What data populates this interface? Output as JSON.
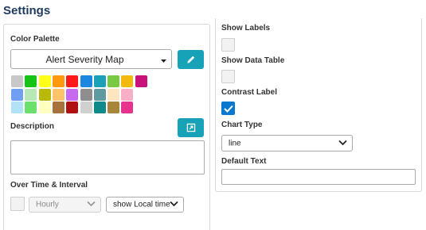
{
  "page": {
    "title": "Settings"
  },
  "left": {
    "color_palette": {
      "label": "Color Palette",
      "selected": "Alert Severity Map",
      "edit_icon": "pencil-icon",
      "swatches": [
        [
          "#c8c8c8",
          "#15c415",
          "#ffff1a",
          "#ff9a0e",
          "#ff1a1a",
          "#1b87e0",
          "#1aa0b8",
          "#7ac943",
          "#f2b90f",
          "#c8127a"
        ],
        [
          "#6f9ff2",
          "#b7e9b7",
          "#b9b90a",
          "#ffc46a",
          "#c86af0",
          "#8e8e8e",
          "#5e9aa0",
          "#fde5c0",
          "#f9aec7"
        ],
        [
          "#b1e2f5",
          "#6be06b",
          "#ffffc0",
          "#a8733a",
          "#b01010",
          "#d0d0d0",
          "#0e8a8a",
          "#a8853a",
          "#e7338e"
        ]
      ]
    },
    "description": {
      "label": "Description",
      "expand_icon": "expand-icon",
      "value": ""
    },
    "over_time": {
      "label": "Over Time & Interval",
      "interval": "Hourly",
      "time_mode": "show Local time"
    }
  },
  "right": {
    "show_labels": {
      "label": "Show Labels",
      "checked": false
    },
    "show_data_table": {
      "label": "Show Data Table",
      "checked": false
    },
    "contrast_label": {
      "label": "Contrast Label",
      "checked": true
    },
    "chart_type": {
      "label": "Chart Type",
      "value": "line"
    },
    "default_text": {
      "label": "Default Text",
      "value": ""
    }
  }
}
